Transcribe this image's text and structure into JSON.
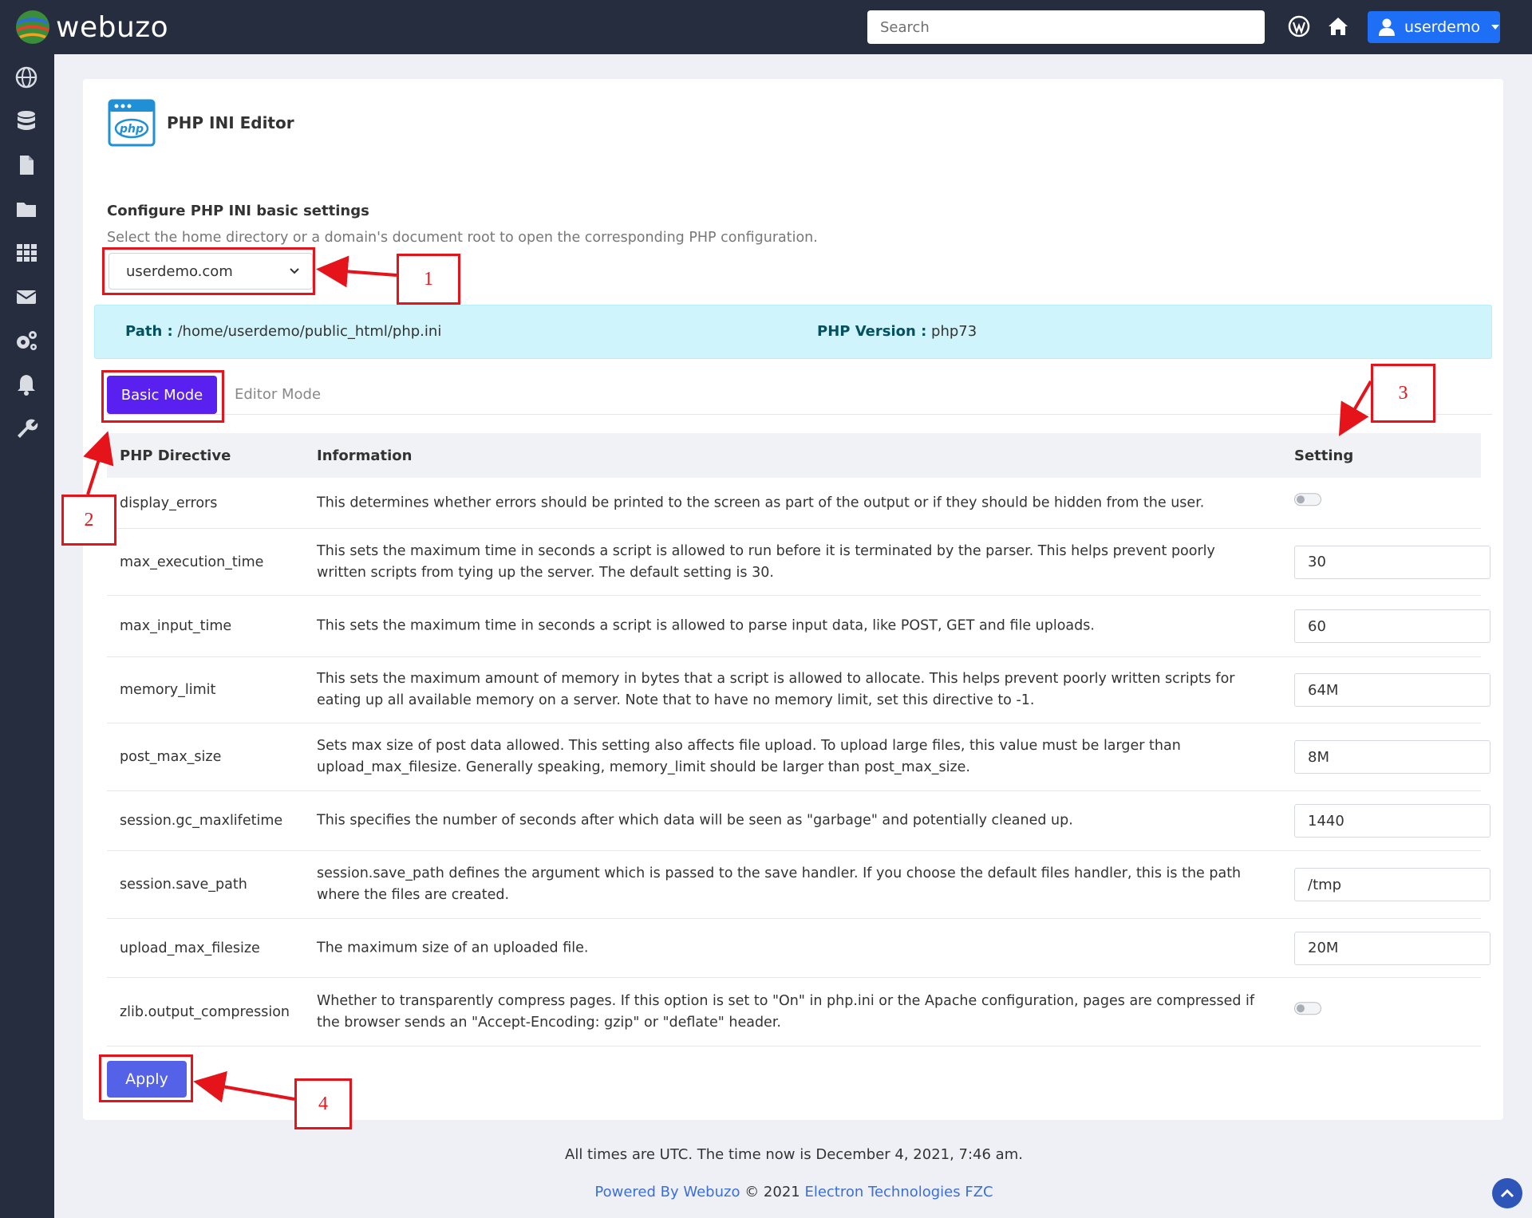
{
  "header": {
    "brand": "webuzo",
    "search_placeholder": "Search",
    "user_label": "userdemo"
  },
  "sidebar": {
    "icons": [
      "globe-icon",
      "database-icon",
      "file-icon",
      "folder-icon",
      "apps-grid-icon",
      "mail-icon",
      "settings-gears-icon",
      "bell-icon",
      "wrench-icon"
    ]
  },
  "page": {
    "title": "PHP INI Editor",
    "section_title": "Configure PHP INI basic settings",
    "section_desc": "Select the home directory or a domain's document root to open the corresponding PHP configuration.",
    "selected_domain": "userdemo.com",
    "path_label": "Path :",
    "path_value": "/home/userdemo/public_html/php.ini",
    "version_label": "PHP Version :",
    "version_value": "php73",
    "tabs": {
      "basic": "Basic Mode",
      "editor": "Editor Mode"
    },
    "apply_label": "Apply"
  },
  "table": {
    "headers": {
      "directive": "PHP Directive",
      "information": "Information",
      "setting": "Setting"
    },
    "rows": [
      {
        "directive": "display_errors",
        "info": "This determines whether errors should be printed to the screen as part of the output or if they should be hidden from the user.",
        "type": "toggle",
        "value": "off"
      },
      {
        "directive": "max_execution_time",
        "info": "This sets the maximum time in seconds a script is allowed to run before it is terminated by the parser. This helps prevent poorly written scripts from tying up the server. The default setting is 30.",
        "type": "input",
        "value": "30"
      },
      {
        "directive": "max_input_time",
        "info": "This sets the maximum time in seconds a script is allowed to parse input data, like POST, GET and file uploads.",
        "type": "input",
        "value": "60"
      },
      {
        "directive": "memory_limit",
        "info": "This sets the maximum amount of memory in bytes that a script is allowed to allocate. This helps prevent poorly written scripts for eating up all available memory on a server. Note that to have no memory limit, set this directive to -1.",
        "type": "input",
        "value": "64M"
      },
      {
        "directive": "post_max_size",
        "info": "Sets max size of post data allowed. This setting also affects file upload. To upload large files, this value must be larger than upload_max_filesize. Generally speaking, memory_limit should be larger than post_max_size.",
        "type": "input",
        "value": "8M"
      },
      {
        "directive": "session.gc_maxlifetime",
        "info": "This specifies the number of seconds after which data will be seen as \"garbage\" and potentially cleaned up.",
        "type": "input",
        "value": "1440"
      },
      {
        "directive": "session.save_path",
        "info": "session.save_path defines the argument which is passed to the save handler. If you choose the default files handler, this is the path where the files are created.",
        "type": "input",
        "value": "/tmp"
      },
      {
        "directive": "upload_max_filesize",
        "info": "The maximum size of an uploaded file.",
        "type": "input",
        "value": "20M"
      },
      {
        "directive": "zlib.output_compression",
        "info": "Whether to transparently compress pages. If this option is set to \"On\" in php.ini or the Apache configuration, pages are compressed if the browser sends an \"Accept-Encoding: gzip\" or \"deflate\" header.",
        "type": "toggle",
        "value": "off"
      }
    ]
  },
  "footer": {
    "time_text": "All times are UTC. The time now is December 4, 2021, 7:46 am.",
    "powered_prefix": "Powered By Webuzo",
    "powered_middle": " © 2021 ",
    "powered_company": "Electron Technologies FZC"
  },
  "annotations": {
    "n1": "1",
    "n2": "2",
    "n3": "3",
    "n4": "4"
  },
  "colors": {
    "accent": "#5a20f0",
    "annotation": "#e4141a",
    "topbar": "#262d3f"
  }
}
